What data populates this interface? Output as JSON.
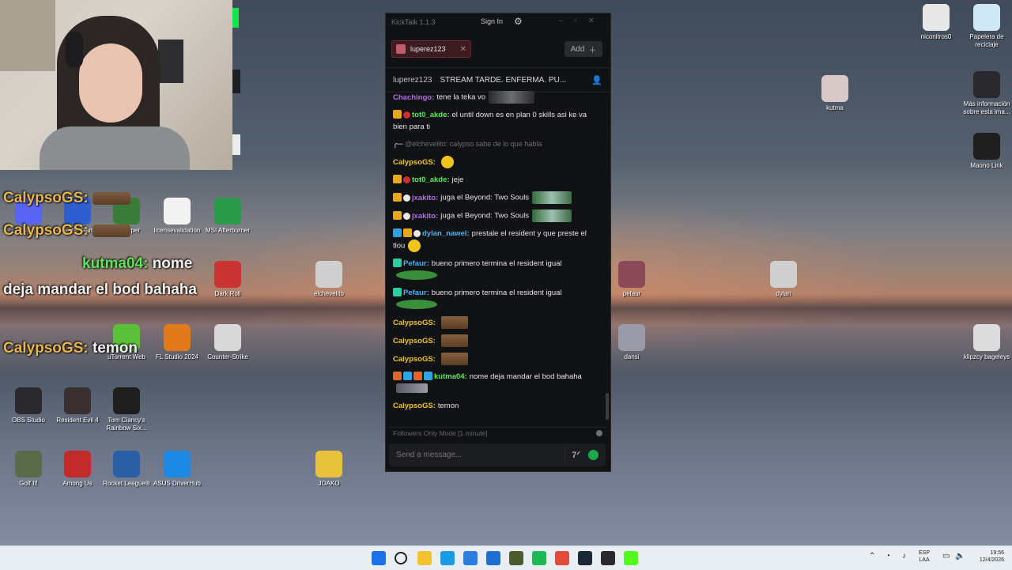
{
  "webcam": {
    "label": "webcam-overlay"
  },
  "overlay_chat": [
    {
      "name": "CalypsoGS:",
      "text": ""
    },
    {
      "name": "CalypsoGS:",
      "text": ""
    },
    {
      "name": "kutma04:",
      "text": "nome"
    },
    {
      "name": "",
      "text": "deja mandar el bod bahaha"
    },
    {
      "name": "CalypsoGS:",
      "text": "temon"
    }
  ],
  "desktop_icons_left": [
    {
      "label": "Discord",
      "icon": "discord-icon",
      "color": "#5865f2"
    },
    {
      "label": "Rockstar Games",
      "icon": "rockstar-icon",
      "color": "#2d5fd1"
    },
    {
      "label": "wallpaper",
      "icon": "wallpaper-icon",
      "color": "#3a7d3a"
    },
    {
      "label": "licensevalidation",
      "icon": "file-icon",
      "color": "#f2f2f2"
    },
    {
      "label": "MSI Afterburner",
      "icon": "msi-icon",
      "color": "#2b9a4a"
    },
    {
      "label": "Dark Roll",
      "icon": "darkroll-icon",
      "color": "#c33"
    },
    {
      "label": "OBS Studio",
      "icon": "obs-icon",
      "color": "#2a2a2e"
    },
    {
      "label": "Resident Evil 4",
      "icon": "re4-icon",
      "color": "#3a3030"
    },
    {
      "label": "Tom Clancy's Rainbow Six...",
      "icon": "r6-icon",
      "color": "#1e1e1e"
    },
    {
      "label": "FL Studio 2024",
      "icon": "flstudio-icon",
      "color": "#e07a1a"
    },
    {
      "label": "Counter-Strike",
      "icon": "cs-icon",
      "color": "#d8d8d8"
    },
    {
      "label": "uTorrent Web",
      "icon": "utorrent-icon",
      "color": "#5bbf3a"
    },
    {
      "label": "Golf It!",
      "icon": "golfit-icon",
      "color": "#5a6b4a"
    },
    {
      "label": "Among Us",
      "icon": "amongus-icon",
      "color": "#c32a2a"
    },
    {
      "label": "Rocket League®",
      "icon": "rocketleague-icon",
      "color": "#2b5fa5"
    },
    {
      "label": "ASUS DriverHub",
      "icon": "asus-icon",
      "color": "#1e88e5"
    },
    {
      "label": "JOAKO",
      "icon": "joako-icon",
      "color": "#e8c23a"
    },
    {
      "label": "elchevelito",
      "icon": "elchevelito-icon",
      "color": "#cfcfcf"
    }
  ],
  "desktop_icons_right": [
    {
      "label": "niconitros0",
      "icon": "niconitros-icon",
      "color": "#e8e8e8"
    },
    {
      "label": "Papelera de reciclaje",
      "icon": "recycle-bin-icon",
      "color": "#cfe6f5"
    },
    {
      "label": "kutma",
      "icon": "kutma-icon",
      "color": "#d8c8c8"
    },
    {
      "label": "Más información sobre esta ima...",
      "icon": "info-icon",
      "color": "#2a2a2e"
    },
    {
      "label": "Maono Link",
      "icon": "maono-icon",
      "color": "#1f1f1f"
    },
    {
      "label": "pefaur",
      "icon": "pefaur-icon",
      "color": "#8a4a5a"
    },
    {
      "label": "dylan",
      "icon": "dylan-icon",
      "color": "#cfcfcf"
    },
    {
      "label": "dansi",
      "icon": "dansi-icon",
      "color": "#9a9aa8"
    },
    {
      "label": "klipzcy bageleys",
      "icon": "klipzcy-icon",
      "color": "#dcdcdc"
    }
  ],
  "kicktalk": {
    "title": "KickTalk 1.1.3",
    "signin": "Sign In",
    "tab_label": "luperez123",
    "add_label": "Add",
    "channel": "luperez123",
    "stream_title": "STREAM TARDE. ENFERMA. PU...",
    "followers_mode": "Followers Only Mode [1 minute]",
    "input_placeholder": "Send a message...",
    "accent": "#53fc18",
    "messages": [
      {
        "user": "Chachingo:",
        "color": "#b26be4",
        "text": "tene la teka vo",
        "emote": "pic"
      },
      {
        "user": "tot0_akde:",
        "color": "#5ce65c",
        "text": "el until down es en plan 0 skills asi ke va bien para ti",
        "badges": [
          "crown",
          "red"
        ]
      },
      {
        "reply": "@elchevelito: calypso sabe de lo que habla"
      },
      {
        "user": "CalypsoGS:",
        "color": "#f0c419",
        "text": "",
        "emote": "smile"
      },
      {
        "user": "tot0_akde:",
        "color": "#5ce65c",
        "text": "jeje",
        "badges": [
          "crown",
          "red"
        ]
      },
      {
        "user": "jxakito:",
        "color": "#b26be4",
        "text": "juga el Beyond: Two Souls",
        "badges": [
          "crown",
          "white"
        ],
        "emote": "green"
      },
      {
        "user": "jxakito:",
        "color": "#b26be4",
        "text": "juga el Beyond: Two Souls",
        "badges": [
          "crown",
          "white"
        ],
        "emote": "green"
      },
      {
        "user": "dylan_nawel:",
        "color": "#4cb1f0",
        "text": "prestale el resident y que preste el tlou",
        "badges": [
          "blue",
          "crown",
          "white"
        ],
        "emote": "smile"
      },
      {
        "user": "Pefaur:",
        "color": "#4cb1f0",
        "text": "bueno primero termina el resident igual",
        "badges": [
          "teal"
        ],
        "emote": "frog"
      },
      {
        "user": "Pefaur:",
        "color": "#4cb1f0",
        "text": "bueno primero termina el resident igual",
        "badges": [
          "teal"
        ],
        "emote": "frog"
      },
      {
        "user": "CalypsoGS:",
        "color": "#f0c419",
        "text": "",
        "emote": "brown"
      },
      {
        "user": "CalypsoGS:",
        "color": "#f0c419",
        "text": "",
        "emote": "brown"
      },
      {
        "user": "CalypsoGS:",
        "color": "#f0c419",
        "text": "",
        "emote": "brown"
      },
      {
        "user": "kutma04:",
        "color": "#5ce65c",
        "text": "nome deja mandar el bod bahaha",
        "badges": [
          "orange",
          "blue",
          "orange",
          "blue"
        ],
        "emote": "cat"
      },
      {
        "user": "CalypsoGS:",
        "color": "#f0c419",
        "text": "temon"
      }
    ]
  },
  "taskbar": {
    "apps": [
      "start-icon",
      "search-icon",
      "file-explorer-icon",
      "edge-icon",
      "store-icon",
      "outlook-icon",
      "game-icon",
      "spotify-icon",
      "chrome-icon",
      "steam-icon",
      "obs-icon",
      "kicktalk-icon"
    ],
    "lang": "ESP",
    "lang_sub": "LAA",
    "time": "19:56",
    "date": "12/4/2026"
  }
}
